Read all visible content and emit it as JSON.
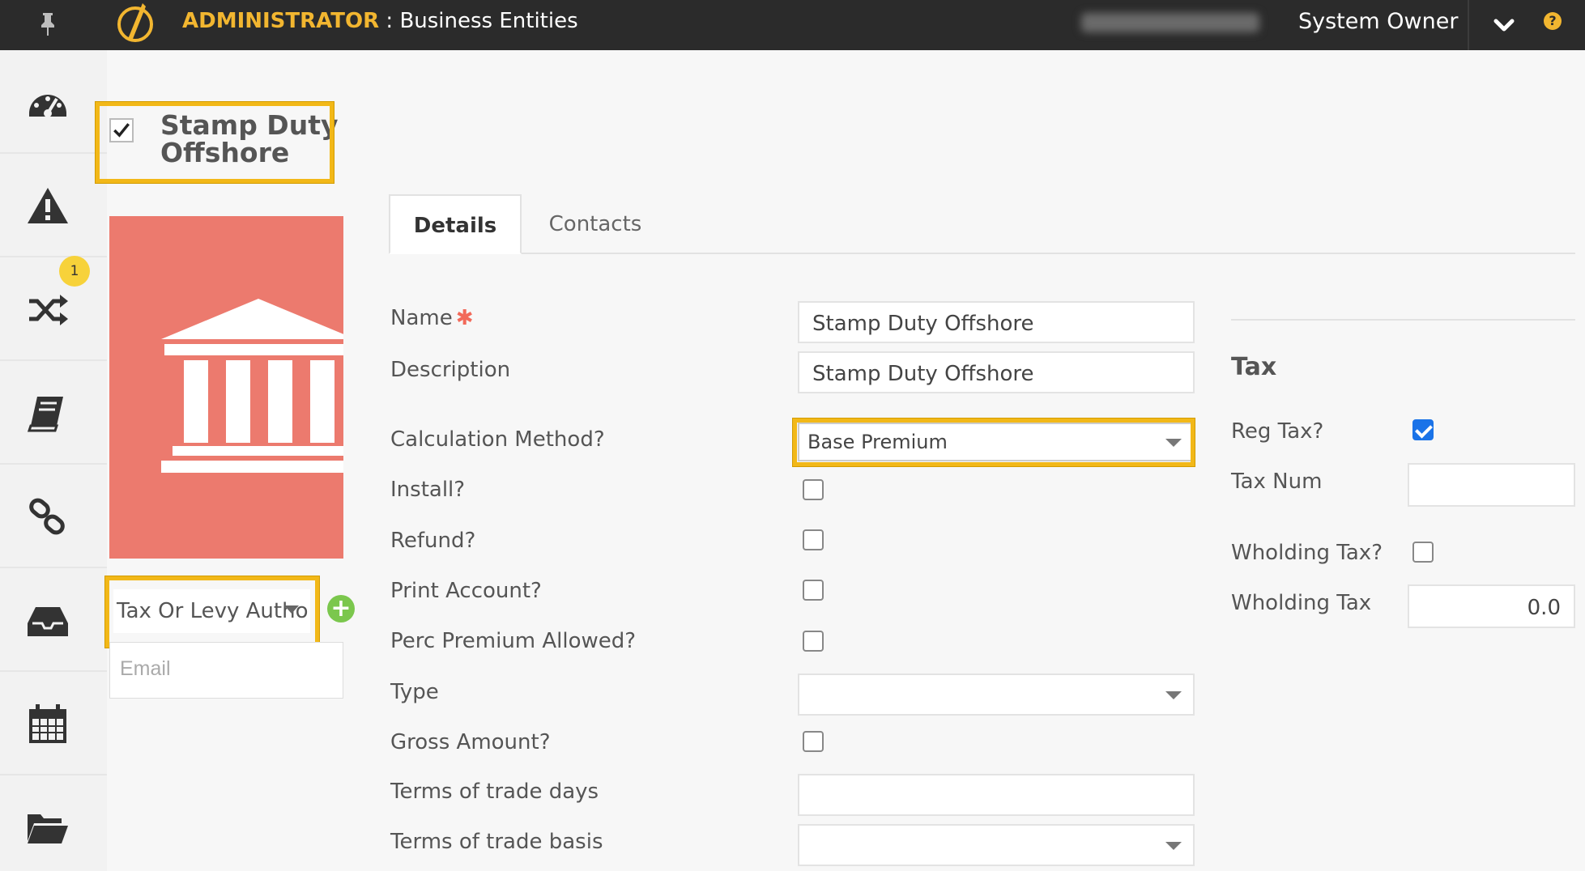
{
  "header": {
    "role": "ADMINISTRATOR",
    "separator": " : ",
    "section": "Business Entities",
    "user": "System Owner",
    "help_glyph": "?",
    "icons": [
      "pin-icon",
      "app-logo-icon",
      "chevron-down-icon",
      "help-icon"
    ]
  },
  "sidebar": {
    "items": [
      {
        "name": "dashboard-icon"
      },
      {
        "name": "alert-icon",
        "badge": "1"
      },
      {
        "name": "shuffle-icon"
      },
      {
        "name": "book-icon"
      },
      {
        "name": "link-icon"
      },
      {
        "name": "inbox-icon"
      },
      {
        "name": "calendar-icon"
      },
      {
        "name": "folder-icon"
      }
    ]
  },
  "entity": {
    "name": "Stamp Duty Offshore",
    "selected": true,
    "type": "Tax Or Levy Autho",
    "email_placeholder": "Email",
    "image_icon": "building-icon",
    "image_color": "#ec7a6e"
  },
  "tabs": [
    {
      "label": "Details",
      "active": true
    },
    {
      "label": "Contacts",
      "active": false
    }
  ],
  "form": {
    "name_label": "Name",
    "required_mark": "✱",
    "name_value": "Stamp Duty Offshore",
    "description_label": "Description",
    "description_value": "Stamp Duty Offshore",
    "calc_method_label": "Calculation Method?",
    "calc_method_value": "Base Premium",
    "install_label": "Install?",
    "refund_label": "Refund?",
    "print_account_label": "Print Account?",
    "perc_premium_label": "Perc Premium Allowed?",
    "type_label": "Type",
    "type_value": "",
    "gross_amount_label": "Gross Amount?",
    "terms_days_label": "Terms of trade days",
    "terms_days_value": "",
    "terms_basis_label": "Terms of trade basis",
    "terms_basis_value": ""
  },
  "tax": {
    "title": "Tax",
    "reg_tax_label": "Reg Tax?",
    "reg_tax_checked": true,
    "tax_num_label": "Tax Num",
    "tax_num_value": "",
    "wholding_tax_q_label": "Wholding Tax?",
    "wholding_tax_label": "Wholding Tax",
    "wholding_tax_value": "0.0"
  },
  "colors": {
    "topbar": "#2b2b2b",
    "accent": "#f2b630",
    "highlight": "#f2b818",
    "add": "#7bc74d",
    "checkbox_checked": "#1a73e8",
    "required": "#f26a5a"
  }
}
